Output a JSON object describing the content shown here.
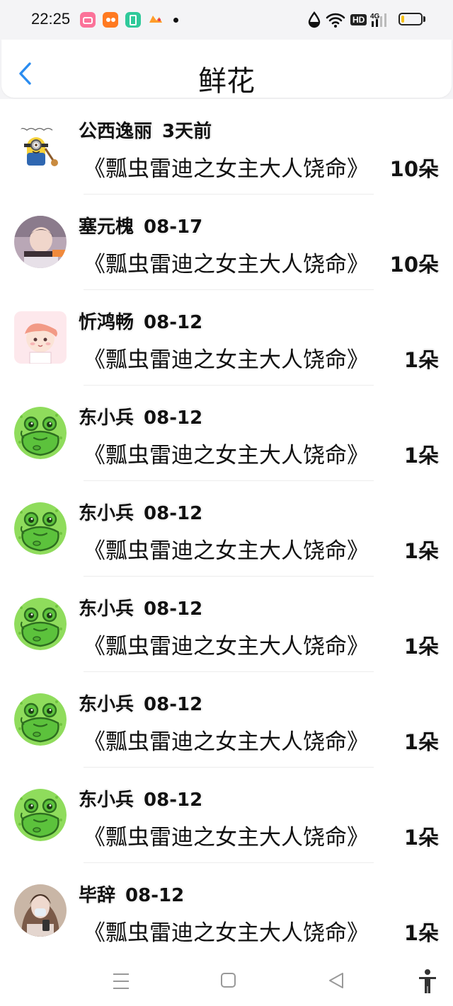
{
  "status_bar": {
    "time": "22:25",
    "app_icons": [
      {
        "name": "bilibili-icon",
        "color": "#fb7299"
      },
      {
        "name": "camera-app-icon",
        "color": "#ff7a21"
      },
      {
        "name": "battery-app-icon",
        "color": "#2fc99a"
      },
      {
        "name": "game-app-icon",
        "color": "#ff9c2a"
      }
    ],
    "network_badge": "HD",
    "network_type": "4G",
    "battery_level": 0.15,
    "battery_color": "#f5c016"
  },
  "header": {
    "title": "鲜花",
    "back_icon": "chevron-left-icon",
    "accent_color": "#2a8cf0"
  },
  "items": [
    {
      "name": "公西逸丽",
      "date": "3天前",
      "book": "《瓢虫雷迪之女主大人饶命》",
      "count": "10朵",
      "avatar": "minion"
    },
    {
      "name": "塞元槐",
      "date": "08-17",
      "book": "《瓢虫雷迪之女主大人饶命》",
      "count": "10朵",
      "avatar": "photo-boy"
    },
    {
      "name": "忻鸿畅",
      "date": "08-12",
      "book": "《瓢虫雷迪之女主大人饶命》",
      "count": "1朵",
      "avatar": "cartoon-boy"
    },
    {
      "name": "东小兵",
      "date": "08-12",
      "book": "《瓢虫雷迪之女主大人饶命》",
      "count": "1朵",
      "avatar": "frog"
    },
    {
      "name": "东小兵",
      "date": "08-12",
      "book": "《瓢虫雷迪之女主大人饶命》",
      "count": "1朵",
      "avatar": "frog"
    },
    {
      "name": "东小兵",
      "date": "08-12",
      "book": "《瓢虫雷迪之女主大人饶命》",
      "count": "1朵",
      "avatar": "frog"
    },
    {
      "name": "东小兵",
      "date": "08-12",
      "book": "《瓢虫雷迪之女主大人饶命》",
      "count": "1朵",
      "avatar": "frog"
    },
    {
      "name": "东小兵",
      "date": "08-12",
      "book": "《瓢虫雷迪之女主大人饶命》",
      "count": "1朵",
      "avatar": "frog"
    },
    {
      "name": "毕辞",
      "date": "08-12",
      "book": "《瓢虫雷迪之女主大人饶命》",
      "count": "1朵",
      "avatar": "photo-girl"
    }
  ],
  "nav_bar": {
    "icons": [
      "menu-icon",
      "home-square-icon",
      "back-triangle-icon",
      "accessibility-icon"
    ]
  }
}
